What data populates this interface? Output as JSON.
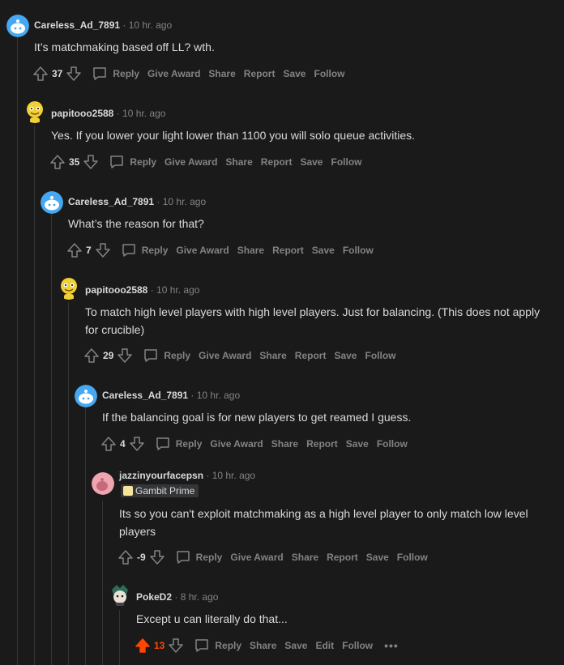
{
  "colors": {
    "background": "#1a1a1b",
    "text": "#d7dadc",
    "muted": "#818384",
    "line": "#343536",
    "upvoted": "#ff4500"
  },
  "labels": {
    "reply": "Reply",
    "give_award": "Give Award",
    "share": "Share",
    "report": "Report",
    "save": "Save",
    "follow": "Follow",
    "edit": "Edit"
  },
  "comments": [
    {
      "user": "Careless_Ad_7891",
      "time": "· 10 hr. ago",
      "avatar": "snoo-blue-avatar",
      "text": "It’s matchmaking based off LL? wth.",
      "score": "37"
    },
    {
      "user": "papitooo2588",
      "time": "· 10 hr. ago",
      "avatar": "yellow-character-avatar",
      "text": "Yes. If you lower your light lower than 1100 you will solo queue activities.",
      "score": "35"
    },
    {
      "user": "Careless_Ad_7891",
      "time": "· 10 hr. ago",
      "avatar": "snoo-blue-avatar",
      "text": "What’s the reason for that?",
      "score": "7"
    },
    {
      "user": "papitooo2588",
      "time": "· 10 hr. ago",
      "avatar": "yellow-character-avatar",
      "text": "To match high level players with high level players. Just for balancing. (This does not apply for crucible)",
      "score": "29"
    },
    {
      "user": "Careless_Ad_7891",
      "time": "· 10 hr. ago",
      "avatar": "snoo-blue-avatar",
      "text": "If the balancing goal is for new players to get reamed I guess.",
      "score": "4"
    },
    {
      "user": "jazzinyourfacepsn",
      "time": "· 10 hr. ago",
      "avatar": "pink-snoo-avatar",
      "flair": "Gambit Prime",
      "text": "Its so you can't exploit matchmaking as a high level player to only match low level players",
      "score": "-9"
    },
    {
      "user": "PokeD2",
      "time": "· 8 hr. ago",
      "avatar": "dark-character-avatar",
      "text": "Except u can literally do that...",
      "score": "13",
      "more": "•••"
    }
  ]
}
